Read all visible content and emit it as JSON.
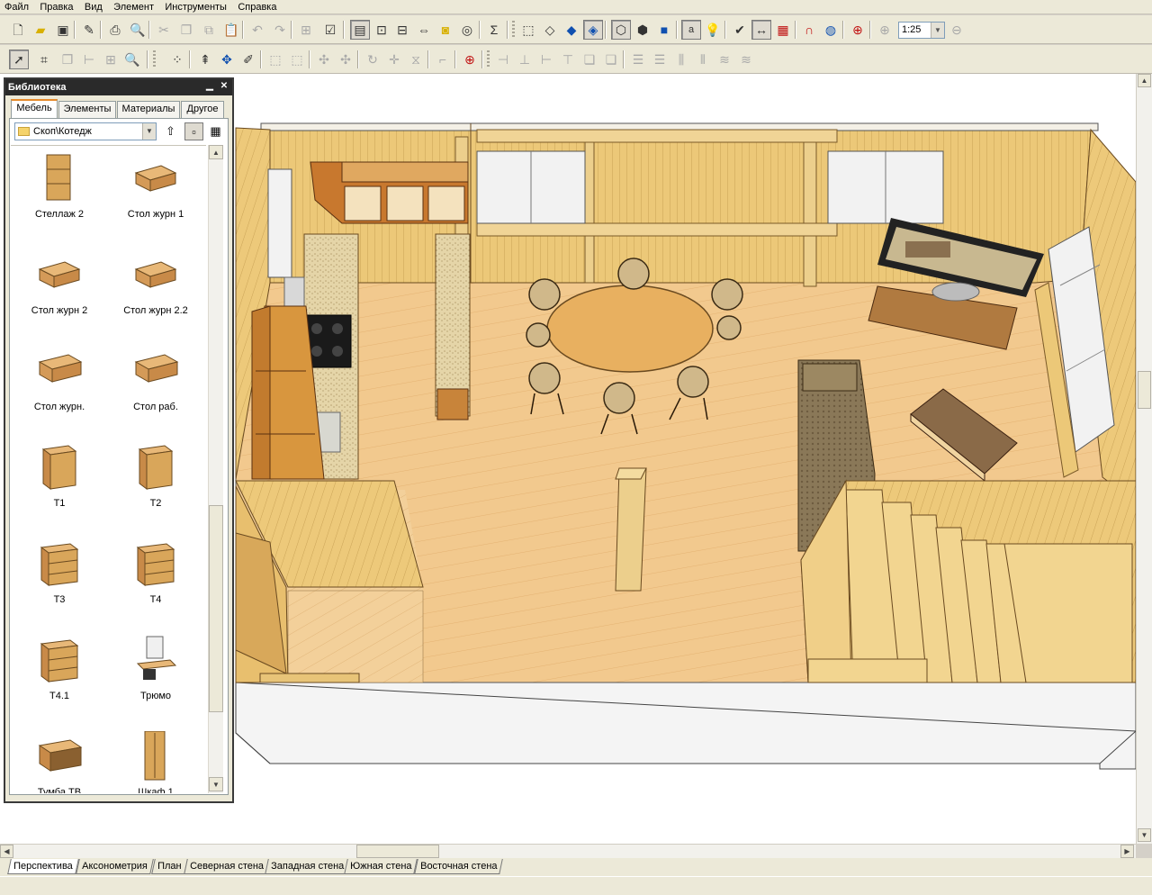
{
  "menu": [
    "Файл",
    "Правка",
    "Вид",
    "Элемент",
    "Инструменты",
    "Справка"
  ],
  "zoom": "1:25",
  "library": {
    "title": "Библиотека",
    "tabs": [
      "Мебель",
      "Элементы",
      "Материалы",
      "Другое"
    ],
    "path": "Скоп\\Котедж",
    "items": [
      {
        "label": "Стеллаж 2",
        "icon": "shelf-icon"
      },
      {
        "label": "Стол журн 1",
        "icon": "coffee-table-icon"
      },
      {
        "label": "Стол журн 2",
        "icon": "coffee-table-icon"
      },
      {
        "label": "Стол журн 2.2",
        "icon": "coffee-table-icon"
      },
      {
        "label": "Стол журн.",
        "icon": "desk-icon"
      },
      {
        "label": "Стол раб.",
        "icon": "desk-icon"
      },
      {
        "label": "Т1",
        "icon": "cabinet-icon"
      },
      {
        "label": "Т2",
        "icon": "cabinet-icon"
      },
      {
        "label": "Т3",
        "icon": "drawers-icon"
      },
      {
        "label": "Т4",
        "icon": "drawers-icon"
      },
      {
        "label": "Т4.1",
        "icon": "drawers-icon"
      },
      {
        "label": "Трюмо",
        "icon": "vanity-icon"
      },
      {
        "label": "Тумба ТВ",
        "icon": "tv-stand-icon"
      },
      {
        "label": "Шкаф 1",
        "icon": "wardrobe-icon"
      }
    ]
  },
  "view_tabs": [
    "Перспектива",
    "Аксонометрия",
    "План",
    "Северная стена",
    "Западная стена",
    "Южная стена",
    "Восточная стена"
  ],
  "active_view_tab": "Перспектива",
  "colors": {
    "wood": "#e8c47a",
    "floor": "#f0c890",
    "panel_title": "#2a2a2a"
  }
}
